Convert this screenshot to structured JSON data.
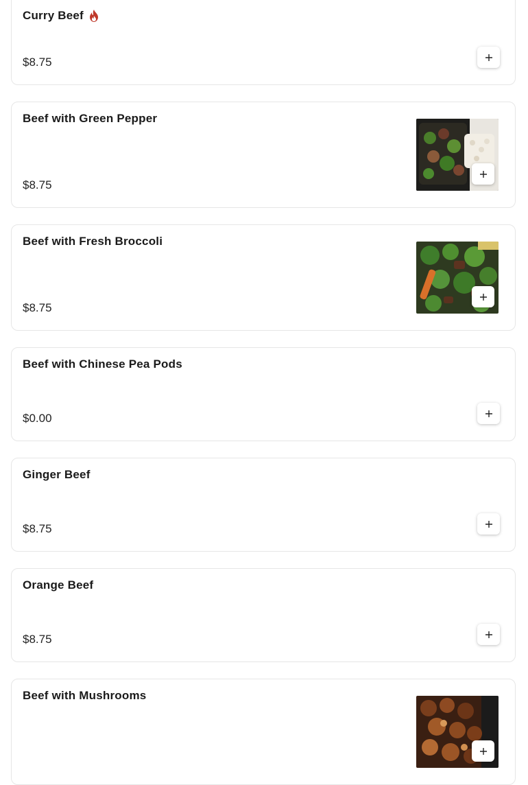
{
  "menu": {
    "items": [
      {
        "name": "Curry Beef",
        "price": "$8.75",
        "spicy": true,
        "icon": "fire-icon",
        "has_image": false
      },
      {
        "name": "Beef with Green Pepper",
        "price": "$8.75",
        "has_image": true,
        "image_icon": "food-photo"
      },
      {
        "name": "Beef with Fresh Broccoli",
        "price": "$8.75",
        "has_image": true,
        "image_icon": "food-photo"
      },
      {
        "name": "Beef with Chinese Pea Pods",
        "price": "$0.00",
        "has_image": false
      },
      {
        "name": "Ginger Beef",
        "price": "$8.75",
        "has_image": false
      },
      {
        "name": "Orange Beef",
        "price": "$8.75",
        "has_image": false
      },
      {
        "name": "Beef with Mushrooms",
        "price": "",
        "has_image": true,
        "image_icon": "food-photo"
      }
    ],
    "add_icon": "plus-icon",
    "colors": {
      "spicy": "#c0392b",
      "card_border": "#e6e6e6"
    }
  }
}
